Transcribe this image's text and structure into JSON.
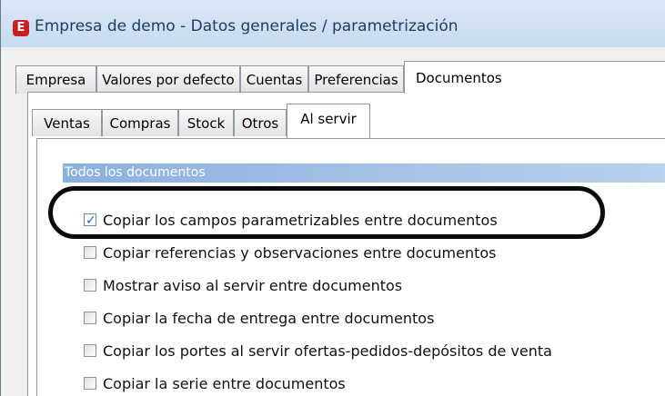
{
  "window": {
    "app_icon_letter": "E",
    "title": "Empresa de demo - Datos generales / parametrización"
  },
  "main_tabs": [
    {
      "label": "Empresa"
    },
    {
      "label": "Valores por defecto"
    },
    {
      "label": "Cuentas"
    },
    {
      "label": "Preferencias"
    },
    {
      "label": "Documentos"
    }
  ],
  "active_main_tab": "Documentos",
  "sub_tabs": [
    {
      "label": "Ventas"
    },
    {
      "label": "Compras"
    },
    {
      "label": "Stock"
    },
    {
      "label": "Otros"
    },
    {
      "label": "Al servir"
    }
  ],
  "active_sub_tab": "Al servir",
  "section": {
    "title": "Todos los documentos"
  },
  "options": [
    {
      "label": "Copiar los campos parametrizables entre documentos",
      "checked": true
    },
    {
      "label": "Copiar referencias y observaciones entre documentos",
      "checked": false
    },
    {
      "label": "Mostrar aviso al servir entre documentos",
      "checked": false
    },
    {
      "label": "Copiar la fecha de entrega entre documentos",
      "checked": false
    },
    {
      "label": "Copiar los portes al servir ofertas-pedidos-depósitos de venta",
      "checked": false
    },
    {
      "label": "Copiar la serie entre documentos",
      "checked": false
    }
  ],
  "colors": {
    "title_text": "#1f3d64",
    "section_header": "#8ab0dc",
    "annotation_outline": "#0a0a0a",
    "app_icon": "#c8201e"
  }
}
